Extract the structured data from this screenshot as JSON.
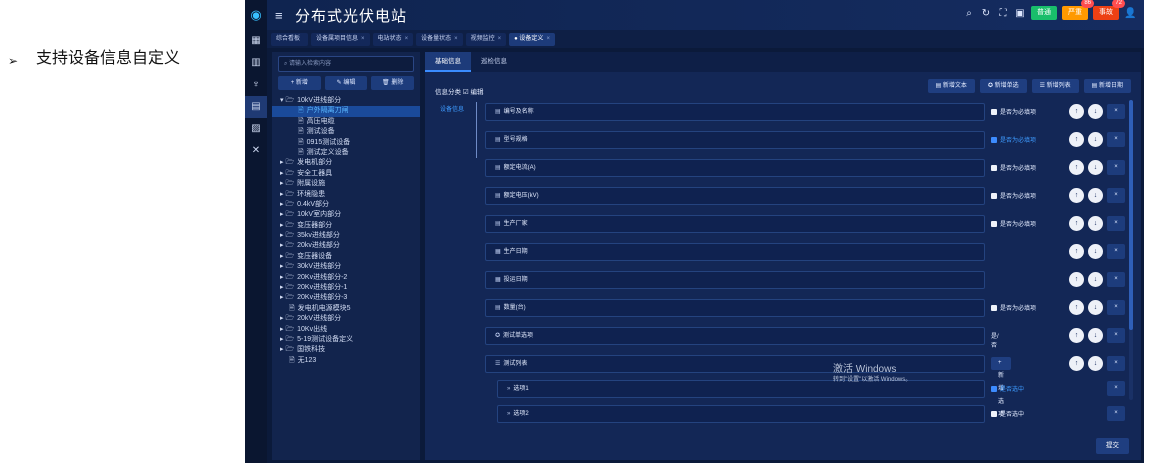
{
  "slide": {
    "bullet_mark": "➢",
    "bullet_text": "支持设备信息自定义"
  },
  "app": {
    "title": "分布式光伏电站",
    "badges": [
      {
        "label": "普通",
        "color": "#19be6b",
        "count": ""
      },
      {
        "label": "严重",
        "color": "#ff9900",
        "count": "86"
      },
      {
        "label": "事故",
        "color": "#ed4014",
        "count": "72"
      }
    ]
  },
  "tabs": [
    {
      "label": "综合看板",
      "close": ""
    },
    {
      "label": "设备属项目信息",
      "close": "×"
    },
    {
      "label": "电站状态",
      "close": "×"
    },
    {
      "label": "设备量状态",
      "close": "×"
    },
    {
      "label": "视频监控",
      "close": "×"
    },
    {
      "label": "● 设备定义",
      "close": "×"
    }
  ],
  "tree": {
    "search_placeholder": "请输入检索内容",
    "buttons": {
      "add": "+ 新增",
      "edit": "✎ 编辑",
      "delete": "🗑 删除"
    },
    "nodes": [
      {
        "label": "10kV进线部分",
        "prefix": "▾ 🗁",
        "indent": 0,
        "selected": false
      },
      {
        "label": "户外隔离刀闸",
        "prefix": "🗎",
        "indent": 2,
        "selected": true
      },
      {
        "label": "高压电缆",
        "prefix": "🗎",
        "indent": 2,
        "selected": false
      },
      {
        "label": "测试设备",
        "prefix": "🗎",
        "indent": 2,
        "selected": false
      },
      {
        "label": "0915测试设备",
        "prefix": "🗎",
        "indent": 2,
        "selected": false
      },
      {
        "label": "测试定义设备",
        "prefix": "🗎",
        "indent": 2,
        "selected": false
      },
      {
        "label": "发电机部分",
        "prefix": "▸ 🗁",
        "indent": 0,
        "selected": false
      },
      {
        "label": "安全工器具",
        "prefix": "▸ 🗁",
        "indent": 0,
        "selected": false
      },
      {
        "label": "附属设施",
        "prefix": "▸ 🗁",
        "indent": 0,
        "selected": false
      },
      {
        "label": "环境隐患",
        "prefix": "▸ 🗁",
        "indent": 0,
        "selected": false
      },
      {
        "label": "0.4kV部分",
        "prefix": "▸ 🗁",
        "indent": 0,
        "selected": false
      },
      {
        "label": "10kV室内部分",
        "prefix": "▸ 🗁",
        "indent": 0,
        "selected": false
      },
      {
        "label": "变压器部分",
        "prefix": "▸ 🗁",
        "indent": 0,
        "selected": false
      },
      {
        "label": "35kv进线部分",
        "prefix": "▸ 🗁",
        "indent": 0,
        "selected": false
      },
      {
        "label": "20kv进线部分",
        "prefix": "▸ 🗁",
        "indent": 0,
        "selected": false
      },
      {
        "label": "变压器设备",
        "prefix": "▸ 🗁",
        "indent": 0,
        "selected": false
      },
      {
        "label": "30kV进线部分",
        "prefix": "▸ 🗁",
        "indent": 0,
        "selected": false
      },
      {
        "label": "20Kv进线部分-2",
        "prefix": "▸ 🗁",
        "indent": 0,
        "selected": false
      },
      {
        "label": "20Kv进线部分-1",
        "prefix": "▸ 🗁",
        "indent": 0,
        "selected": false
      },
      {
        "label": "20Kv进线部分-3",
        "prefix": "▸ 🗁",
        "indent": 0,
        "selected": false
      },
      {
        "label": "发电机电源模块5",
        "prefix": "🗎",
        "indent": 1,
        "selected": false
      },
      {
        "label": "20kV进线部分",
        "prefix": "▸ 🗁",
        "indent": 0,
        "selected": false
      },
      {
        "label": "10Kv出线",
        "prefix": "▸ 🗁",
        "indent": 0,
        "selected": false
      },
      {
        "label": "5-19测试设备定义",
        "prefix": "▸ 🗁",
        "indent": 0,
        "selected": false
      },
      {
        "label": "国铁科技",
        "prefix": "▸ 🗁",
        "indent": 0,
        "selected": false
      },
      {
        "label": "无123",
        "prefix": "🗎",
        "indent": 1,
        "selected": false
      }
    ]
  },
  "main": {
    "tabs": [
      "基础信息",
      "巡检信息"
    ],
    "category": "信息分类 ☑ 编辑",
    "side_label": "设备信息",
    "actions": [
      "▤ 新增文本",
      "✪ 新增单选",
      "☰ 新增列表",
      "▤ 新增日期"
    ],
    "required_label": "是否为必填项",
    "add_option": "+ 新增选项",
    "yes_no": "是/否",
    "option_default_label": "是否选中",
    "submit": "提交",
    "up": "↑",
    "down": "↓",
    "close": "×",
    "fields": [
      {
        "icon": "▤",
        "label": "编号及名称",
        "kind": "text",
        "checked": false
      },
      {
        "icon": "▤",
        "label": "型号规格",
        "kind": "text",
        "checked": true
      },
      {
        "icon": "▤",
        "label": "额定电流(A)",
        "kind": "text",
        "checked": false
      },
      {
        "icon": "▤",
        "label": "额定电压(kV)",
        "kind": "text",
        "checked": false
      },
      {
        "icon": "▤",
        "label": "生产厂家",
        "kind": "text",
        "checked": false
      },
      {
        "icon": "▦",
        "label": "生产日期",
        "kind": "date",
        "checked": false
      },
      {
        "icon": "▦",
        "label": "投运日期",
        "kind": "date",
        "checked": false
      },
      {
        "icon": "▤",
        "label": "数量(台)",
        "kind": "text",
        "checked": false
      },
      {
        "icon": "✪",
        "label": "测试单选项",
        "kind": "radio",
        "checked": false
      },
      {
        "icon": "☰",
        "label": "测试列表",
        "kind": "list",
        "checked": false
      },
      {
        "icon": "»",
        "label": "选项1",
        "kind": "option",
        "checked": true
      },
      {
        "icon": "»",
        "label": "选项2",
        "kind": "option",
        "checked": false
      }
    ]
  },
  "watermark": {
    "title": "激活 Windows",
    "sub": "转到\"设置\"以激活 Windows。"
  }
}
